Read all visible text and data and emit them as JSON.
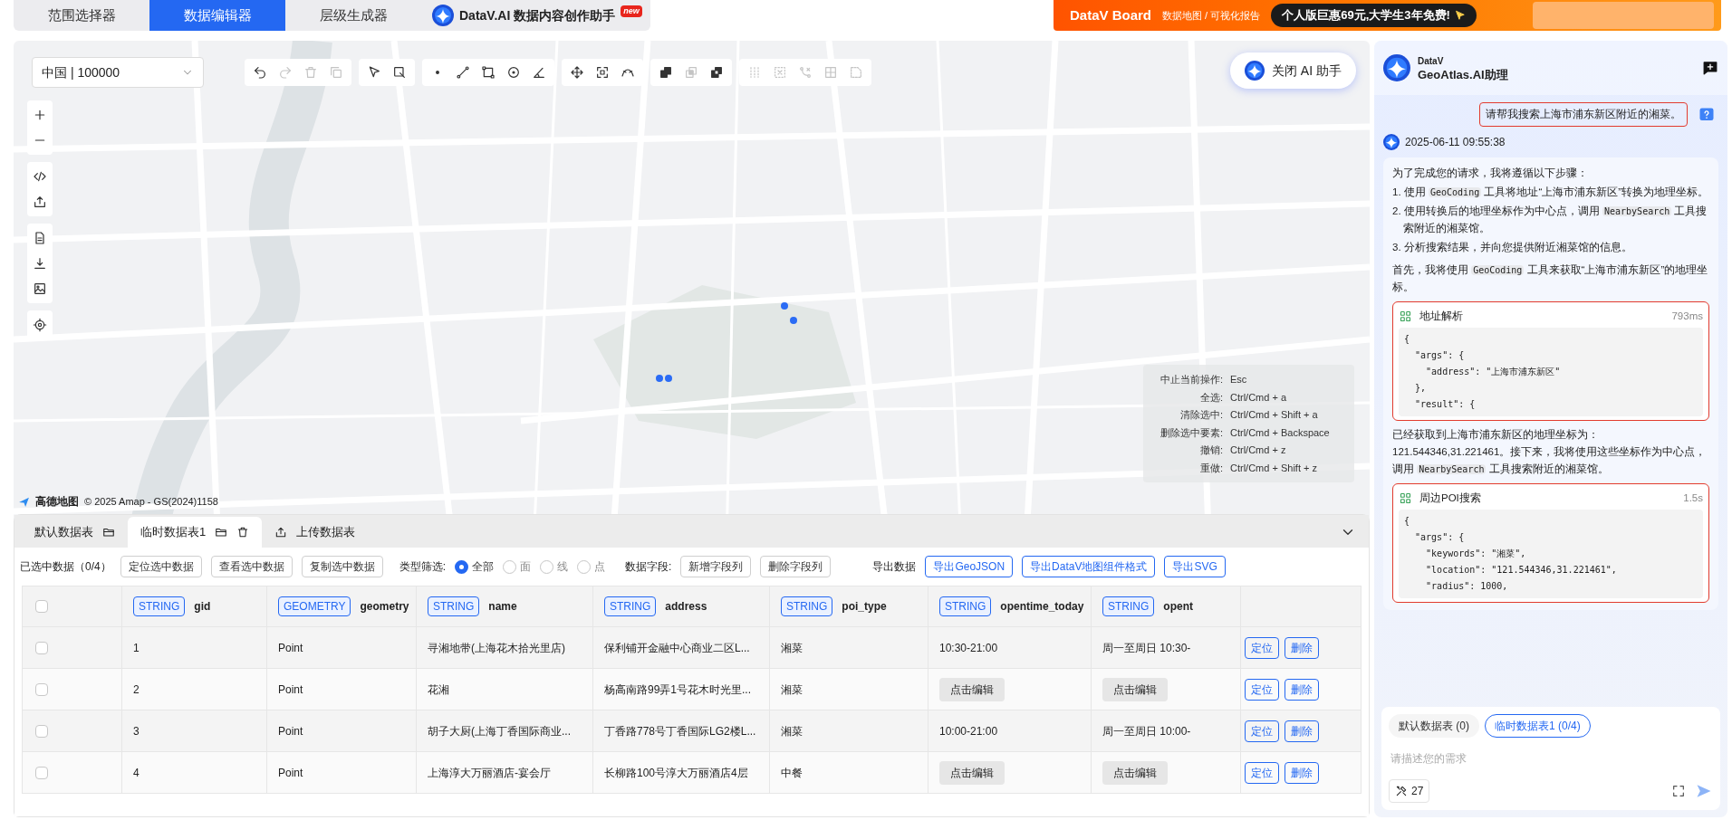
{
  "top_tabs": [
    {
      "label": "范围选择器",
      "selected": false
    },
    {
      "label": "数据编辑器",
      "selected": true
    },
    {
      "label": "层级生成器",
      "selected": false
    }
  ],
  "ai_brand": {
    "label": "DataV.AI 数据内容创作助手",
    "badge": "new"
  },
  "banner": {
    "brand": "DataV Board",
    "subtitle": "数据地图 / 可视化报告",
    "promo": "个人版巨惠69元,大学生3年免费!"
  },
  "map": {
    "region_select": "中国 | 100000",
    "toolbar": [
      {
        "tools": [
          {
            "disabled": false
          },
          {
            "disabled": true
          },
          {
            "disabled": true
          },
          {
            "disabled": true
          }
        ]
      },
      {
        "tools": [
          {
            "disabled": false
          },
          {
            "disabled": false
          }
        ]
      },
      {
        "tools": [
          {
            "disabled": false
          },
          {
            "disabled": false
          },
          {
            "disabled": false
          },
          {
            "disabled": false
          },
          {
            "disabled": false
          }
        ]
      },
      {
        "tools": [
          {
            "disabled": false
          },
          {
            "disabled": false
          },
          {
            "disabled": false
          }
        ]
      },
      {
        "tools": [
          {
            "disabled": false
          },
          {
            "disabled": true
          },
          {
            "disabled": false
          }
        ]
      },
      {
        "tools": [
          {
            "disabled": true
          },
          {
            "disabled": true
          },
          {
            "disabled": true
          },
          {
            "disabled": true
          },
          {
            "disabled": true
          }
        ]
      }
    ],
    "ai_toggle": "关闭 AI 助手",
    "shortcuts": [
      {
        "action": "中止当前操作:",
        "keys": "Esc"
      },
      {
        "action": "全选:",
        "keys": "Ctrl/Cmd + a"
      },
      {
        "action": "清除选中:",
        "keys": "Ctrl/Cmd + Shift + a"
      },
      {
        "action": "删除选中要素:",
        "keys": "Ctrl/Cmd + Backspace"
      },
      {
        "action": "撤销:",
        "keys": "Ctrl/Cmd + z"
      },
      {
        "action": "重做:",
        "keys": "Ctrl/Cmd + Shift + z"
      }
    ],
    "attribution": {
      "logo": "高德地图",
      "text": "© 2025 Amap - GS(2024)1158"
    }
  },
  "data_panel": {
    "tabs": [
      {
        "label": "默认数据表",
        "selected": false
      },
      {
        "label": "临时数据表1",
        "selected": true
      },
      {
        "label": "上传数据表",
        "selected": false
      }
    ],
    "selection_label": "已选中数据（0/4）",
    "selection_buttons": [
      "定位选中数据",
      "查看选中数据",
      "复制选中数据"
    ],
    "type_filter": {
      "label": "类型筛选:",
      "options": [
        {
          "label": "全部",
          "selected": true
        },
        {
          "label": "面",
          "selected": false
        },
        {
          "label": "线",
          "selected": false
        },
        {
          "label": "点",
          "selected": false
        }
      ]
    },
    "field_label": "数据字段:",
    "field_buttons": [
      "新增字段列",
      "删除字段列"
    ],
    "export_label": "导出数据",
    "export_buttons": [
      "导出GeoJSON",
      "导出DataV地图组件格式",
      "导出SVG"
    ],
    "table": {
      "all_checked": false,
      "columns": [
        {
          "type": "STRING",
          "name": "gid"
        },
        {
          "type": "GEOMETRY",
          "name": "geometry"
        },
        {
          "type": "STRING",
          "name": "name"
        },
        {
          "type": "STRING",
          "name": "address"
        },
        {
          "type": "STRING",
          "name": "poi_type"
        },
        {
          "type": "STRING",
          "name": "opentime_today"
        },
        {
          "type": "STRING",
          "name": "opent"
        }
      ],
      "rows": [
        {
          "checked": false,
          "cells": [
            {
              "kind": "text",
              "text": "1"
            },
            {
              "kind": "text",
              "text": "Point"
            },
            {
              "kind": "text",
              "text": "寻湘地带(上海花木拾光里店)"
            },
            {
              "kind": "text",
              "text": "保利铺开金融中心商业二区L..."
            },
            {
              "kind": "text",
              "text": "湘菜"
            },
            {
              "kind": "text",
              "text": "10:30-21:00"
            },
            {
              "kind": "text",
              "text": "周一至周日 10:30-"
            }
          ],
          "actions": [
            "定位",
            "删除"
          ]
        },
        {
          "checked": false,
          "cells": [
            {
              "kind": "text",
              "text": "2"
            },
            {
              "kind": "text",
              "text": "Point"
            },
            {
              "kind": "text",
              "text": "花湘"
            },
            {
              "kind": "text",
              "text": "杨高南路99弄1号花木时光里..."
            },
            {
              "kind": "text",
              "text": "湘菜"
            },
            {
              "kind": "edit",
              "text": "点击编辑"
            },
            {
              "kind": "edit",
              "text": "点击编辑"
            }
          ],
          "actions": [
            "定位",
            "删除"
          ]
        },
        {
          "checked": false,
          "cells": [
            {
              "kind": "text",
              "text": "3"
            },
            {
              "kind": "text",
              "text": "Point"
            },
            {
              "kind": "text",
              "text": "胡子大厨(上海丁香国际商业..."
            },
            {
              "kind": "text",
              "text": "丁香路778号丁香国际LG2楼L..."
            },
            {
              "kind": "text",
              "text": "湘菜"
            },
            {
              "kind": "text",
              "text": "10:00-21:00"
            },
            {
              "kind": "text",
              "text": "周一至周日 10:00-"
            }
          ],
          "actions": [
            "定位",
            "删除"
          ]
        },
        {
          "checked": false,
          "cells": [
            {
              "kind": "text",
              "text": "4"
            },
            {
              "kind": "text",
              "text": "Point"
            },
            {
              "kind": "text",
              "text": "上海淳大万丽酒店-宴会厅"
            },
            {
              "kind": "text",
              "text": "长柳路100号淳大万丽酒店4层"
            },
            {
              "kind": "text",
              "text": "中餐"
            },
            {
              "kind": "edit",
              "text": "点击编辑"
            },
            {
              "kind": "edit",
              "text": "点击编辑"
            }
          ],
          "actions": [
            "定位",
            "删除"
          ]
        }
      ]
    }
  },
  "assistant": {
    "brand_small": "DataV",
    "title": "GeoAtlas.AI助理",
    "user_message": "请帮我搜索上海市浦东新区附近的湘菜。",
    "reply_time": "2025-06-11 09:55:38",
    "blocks": [
      {
        "kind": "para",
        "segments": [
          {
            "kind": "text",
            "text": "为了完成您的请求，我将遵循以下步骤："
          }
        ]
      },
      {
        "kind": "item",
        "marker": "1.",
        "segments": [
          {
            "kind": "text",
            "text": "使用 "
          },
          {
            "kind": "code",
            "text": "GeoCoding"
          },
          {
            "kind": "text",
            "text": " 工具将地址“上海市浦东新区”转换为地理坐标。"
          }
        ]
      },
      {
        "kind": "item",
        "marker": "2.",
        "segments": [
          {
            "kind": "text",
            "text": "使用转换后的地理坐标作为中心点，调用 "
          },
          {
            "kind": "code",
            "text": "NearbySearch"
          },
          {
            "kind": "text",
            "text": " 工具搜索附近的湘菜馆。"
          }
        ]
      },
      {
        "kind": "item",
        "marker": "3.",
        "segments": [
          {
            "kind": "text",
            "text": "分析搜索结果，并向您提供附近湘菜馆的信息。"
          }
        ]
      },
      {
        "kind": "para",
        "segments": [
          {
            "kind": "text",
            "text": "首先，我将使用 "
          },
          {
            "kind": "code",
            "text": "GeoCoding"
          },
          {
            "kind": "text",
            "text": " 工具来获取“上海市浦东新区”的地理坐标。"
          }
        ]
      },
      {
        "kind": "tool",
        "title": "地址解析",
        "duration": "793ms",
        "code_lines": [
          "{",
          "  \"args\": {",
          "    \"address\": \"上海市浦东新区\"",
          "  },",
          "  \"result\": {"
        ]
      },
      {
        "kind": "para",
        "segments": [
          {
            "kind": "text",
            "text": "已经获取到上海市浦东新区的地理坐标为：121.544346,31.221461。接下来，我将使用这些坐标作为中心点，调用 "
          },
          {
            "kind": "code",
            "text": "NearbySearch"
          },
          {
            "kind": "text",
            "text": " 工具搜索附近的湘菜馆。"
          }
        ]
      },
      {
        "kind": "tool",
        "title": "周边POI搜索",
        "duration": "1.5s",
        "code_lines": [
          "{",
          "  \"args\": {",
          "    \"keywords\": \"湘菜\",",
          "    \"location\": \"121.544346,31.221461\",",
          "    \"radius\": 1000,"
        ]
      }
    ],
    "composer": {
      "tabs": [
        {
          "label": "默认数据表 (0)",
          "selected": false
        },
        {
          "label": "临时数据表1 (0/4)",
          "selected": true
        }
      ],
      "placeholder": "请描述您的需求",
      "tool_count": "27"
    }
  }
}
